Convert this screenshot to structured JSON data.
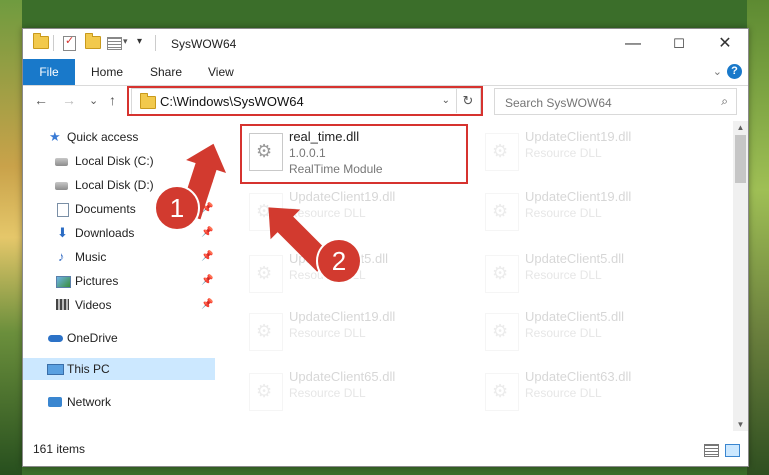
{
  "window": {
    "title": "SysWOW64"
  },
  "title_bar": {
    "minimize": "—",
    "maximize": "☐",
    "close": "✕"
  },
  "ribbon": {
    "tabs": [
      {
        "label": "File"
      },
      {
        "label": "Home"
      },
      {
        "label": "Share"
      },
      {
        "label": "View"
      }
    ],
    "collapse_glyph": "⌄",
    "help_glyph": "?"
  },
  "navigation": {
    "back_glyph": "←",
    "forward_glyph": "→",
    "recent_glyph": "⌄",
    "up_glyph": "↑",
    "address": "C:\\Windows\\SysWOW64",
    "address_dropdown_glyph": "⌄",
    "refresh_glyph": "↻",
    "search_placeholder": "Search SysWOW64"
  },
  "sidebar": {
    "items": [
      {
        "label": "Quick access",
        "icon": "star-icon",
        "pinned": false
      },
      {
        "label": "Local Disk (C:)",
        "icon": "disk-icon",
        "pinned": true
      },
      {
        "label": "Local Disk (D:)",
        "icon": "disk-icon",
        "pinned": true
      },
      {
        "label": "Documents",
        "icon": "document-icon",
        "pinned": true
      },
      {
        "label": "Downloads",
        "icon": "download-icon",
        "pinned": true
      },
      {
        "label": "Music",
        "icon": "music-icon",
        "pinned": true
      },
      {
        "label": "Pictures",
        "icon": "pictures-icon",
        "pinned": true
      },
      {
        "label": "Videos",
        "icon": "videos-icon",
        "pinned": true
      },
      {
        "label": "OneDrive",
        "icon": "cloud-icon",
        "pinned": false
      },
      {
        "label": "This PC",
        "icon": "computer-icon",
        "pinned": false,
        "selected": true
      },
      {
        "label": "Network",
        "icon": "network-icon",
        "pinned": false
      }
    ],
    "pin_glyph": "📌"
  },
  "files": [
    {
      "name": "real_time.dll",
      "version": "1.0.0.1",
      "description": "RealTime Module",
      "highlighted": true
    },
    {
      "name": "UpdateClient19.dll",
      "description": "Resource DLL"
    },
    {
      "name": "UpdateClient19.dll",
      "description": "Resource DLL"
    },
    {
      "name": "UpdateClient19.dll",
      "description": "Resource DLL"
    },
    {
      "name": "UpdateClient5.dll",
      "description": "Resource DLL"
    },
    {
      "name": "UpdateClient5.dll",
      "description": "Resource DLL"
    },
    {
      "name": "UpdateClient19.dll",
      "description": "Resource DLL"
    },
    {
      "name": "UpdateClient5.dll",
      "description": "Resource DLL"
    },
    {
      "name": "UpdateClient65.dll",
      "description": "Resource DLL"
    },
    {
      "name": "UpdateClient63.dll",
      "description": "Resource DLL"
    }
  ],
  "status": {
    "item_count": "161 items"
  },
  "annotations": [
    {
      "label": "1"
    },
    {
      "label": "2"
    }
  ],
  "colors": {
    "accent": "#1979ca",
    "highlight": "#d6332f",
    "selection": "#cce8ff"
  }
}
